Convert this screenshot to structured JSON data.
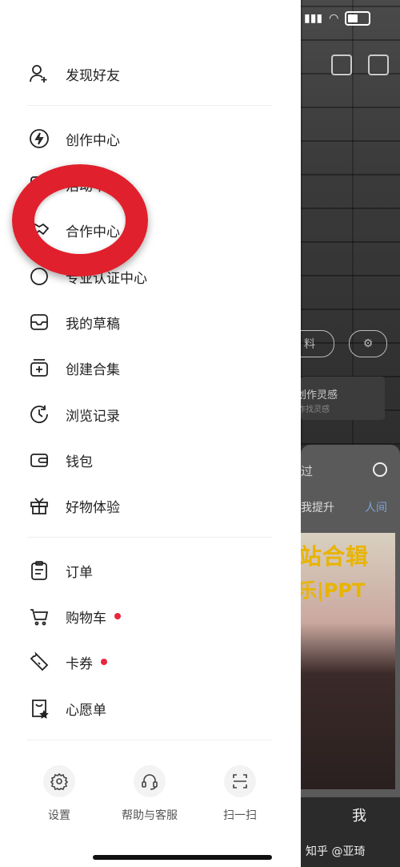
{
  "drawer": {
    "items": [
      {
        "label": "发现好友",
        "icon": "add-user-icon"
      },
      {
        "label": "创作中心",
        "icon": "lightning-icon"
      },
      {
        "label": "活动中心",
        "icon": "activity-icon"
      },
      {
        "label": "合作中心",
        "icon": "handshake-icon"
      },
      {
        "label": "专业认证中心",
        "icon": "badge-icon"
      },
      {
        "label": "我的草稿",
        "icon": "inbox-icon"
      },
      {
        "label": "创建合集",
        "icon": "collection-plus-icon"
      },
      {
        "label": "浏览记录",
        "icon": "history-icon"
      },
      {
        "label": "钱包",
        "icon": "wallet-icon"
      },
      {
        "label": "好物体验",
        "icon": "gift-icon"
      },
      {
        "label": "订单",
        "icon": "clipboard-icon"
      },
      {
        "label": "购物车",
        "icon": "cart-icon"
      },
      {
        "label": "卡券",
        "icon": "coupon-icon"
      },
      {
        "label": "心愿单",
        "icon": "wishlist-icon"
      }
    ],
    "bottom": {
      "settings": "设置",
      "help": "帮助与客服",
      "scan": "扫一扫"
    }
  },
  "background": {
    "pill_profile": "料",
    "inspiration_title": "创作灵感",
    "inspiration_sub": "作找灵感",
    "search_hint": "过",
    "tag1": "我提升",
    "tag2": "人间",
    "thumb_line1": "站合辑",
    "thumb_line2": "乐|PPT",
    "tab_me": "我",
    "watermark": "知乎 @亚琦"
  },
  "colors": {
    "badge_dot": "#e8263d",
    "annotation_ring": "#e0202c"
  }
}
